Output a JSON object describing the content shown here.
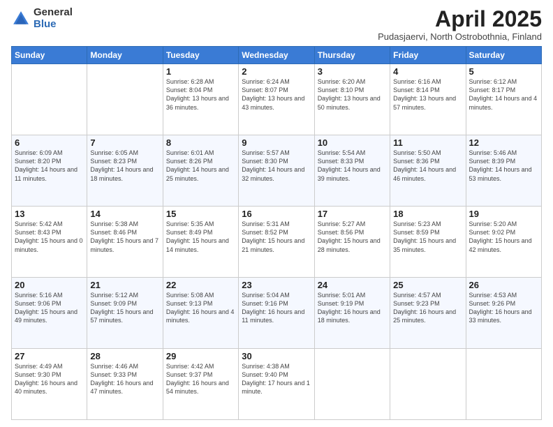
{
  "logo": {
    "general": "General",
    "blue": "Blue"
  },
  "title": "April 2025",
  "subtitle": "Pudasjaervi, North Ostrobothnia, Finland",
  "weekdays": [
    "Sunday",
    "Monday",
    "Tuesday",
    "Wednesday",
    "Thursday",
    "Friday",
    "Saturday"
  ],
  "weeks": [
    [
      {
        "day": "",
        "sunrise": "",
        "sunset": "",
        "daylight": ""
      },
      {
        "day": "",
        "sunrise": "",
        "sunset": "",
        "daylight": ""
      },
      {
        "day": "1",
        "sunrise": "Sunrise: 6:28 AM",
        "sunset": "Sunset: 8:04 PM",
        "daylight": "Daylight: 13 hours and 36 minutes."
      },
      {
        "day": "2",
        "sunrise": "Sunrise: 6:24 AM",
        "sunset": "Sunset: 8:07 PM",
        "daylight": "Daylight: 13 hours and 43 minutes."
      },
      {
        "day": "3",
        "sunrise": "Sunrise: 6:20 AM",
        "sunset": "Sunset: 8:10 PM",
        "daylight": "Daylight: 13 hours and 50 minutes."
      },
      {
        "day": "4",
        "sunrise": "Sunrise: 6:16 AM",
        "sunset": "Sunset: 8:14 PM",
        "daylight": "Daylight: 13 hours and 57 minutes."
      },
      {
        "day": "5",
        "sunrise": "Sunrise: 6:12 AM",
        "sunset": "Sunset: 8:17 PM",
        "daylight": "Daylight: 14 hours and 4 minutes."
      }
    ],
    [
      {
        "day": "6",
        "sunrise": "Sunrise: 6:09 AM",
        "sunset": "Sunset: 8:20 PM",
        "daylight": "Daylight: 14 hours and 11 minutes."
      },
      {
        "day": "7",
        "sunrise": "Sunrise: 6:05 AM",
        "sunset": "Sunset: 8:23 PM",
        "daylight": "Daylight: 14 hours and 18 minutes."
      },
      {
        "day": "8",
        "sunrise": "Sunrise: 6:01 AM",
        "sunset": "Sunset: 8:26 PM",
        "daylight": "Daylight: 14 hours and 25 minutes."
      },
      {
        "day": "9",
        "sunrise": "Sunrise: 5:57 AM",
        "sunset": "Sunset: 8:30 PM",
        "daylight": "Daylight: 14 hours and 32 minutes."
      },
      {
        "day": "10",
        "sunrise": "Sunrise: 5:54 AM",
        "sunset": "Sunset: 8:33 PM",
        "daylight": "Daylight: 14 hours and 39 minutes."
      },
      {
        "day": "11",
        "sunrise": "Sunrise: 5:50 AM",
        "sunset": "Sunset: 8:36 PM",
        "daylight": "Daylight: 14 hours and 46 minutes."
      },
      {
        "day": "12",
        "sunrise": "Sunrise: 5:46 AM",
        "sunset": "Sunset: 8:39 PM",
        "daylight": "Daylight: 14 hours and 53 minutes."
      }
    ],
    [
      {
        "day": "13",
        "sunrise": "Sunrise: 5:42 AM",
        "sunset": "Sunset: 8:43 PM",
        "daylight": "Daylight: 15 hours and 0 minutes."
      },
      {
        "day": "14",
        "sunrise": "Sunrise: 5:38 AM",
        "sunset": "Sunset: 8:46 PM",
        "daylight": "Daylight: 15 hours and 7 minutes."
      },
      {
        "day": "15",
        "sunrise": "Sunrise: 5:35 AM",
        "sunset": "Sunset: 8:49 PM",
        "daylight": "Daylight: 15 hours and 14 minutes."
      },
      {
        "day": "16",
        "sunrise": "Sunrise: 5:31 AM",
        "sunset": "Sunset: 8:52 PM",
        "daylight": "Daylight: 15 hours and 21 minutes."
      },
      {
        "day": "17",
        "sunrise": "Sunrise: 5:27 AM",
        "sunset": "Sunset: 8:56 PM",
        "daylight": "Daylight: 15 hours and 28 minutes."
      },
      {
        "day": "18",
        "sunrise": "Sunrise: 5:23 AM",
        "sunset": "Sunset: 8:59 PM",
        "daylight": "Daylight: 15 hours and 35 minutes."
      },
      {
        "day": "19",
        "sunrise": "Sunrise: 5:20 AM",
        "sunset": "Sunset: 9:02 PM",
        "daylight": "Daylight: 15 hours and 42 minutes."
      }
    ],
    [
      {
        "day": "20",
        "sunrise": "Sunrise: 5:16 AM",
        "sunset": "Sunset: 9:06 PM",
        "daylight": "Daylight: 15 hours and 49 minutes."
      },
      {
        "day": "21",
        "sunrise": "Sunrise: 5:12 AM",
        "sunset": "Sunset: 9:09 PM",
        "daylight": "Daylight: 15 hours and 57 minutes."
      },
      {
        "day": "22",
        "sunrise": "Sunrise: 5:08 AM",
        "sunset": "Sunset: 9:13 PM",
        "daylight": "Daylight: 16 hours and 4 minutes."
      },
      {
        "day": "23",
        "sunrise": "Sunrise: 5:04 AM",
        "sunset": "Sunset: 9:16 PM",
        "daylight": "Daylight: 16 hours and 11 minutes."
      },
      {
        "day": "24",
        "sunrise": "Sunrise: 5:01 AM",
        "sunset": "Sunset: 9:19 PM",
        "daylight": "Daylight: 16 hours and 18 minutes."
      },
      {
        "day": "25",
        "sunrise": "Sunrise: 4:57 AM",
        "sunset": "Sunset: 9:23 PM",
        "daylight": "Daylight: 16 hours and 25 minutes."
      },
      {
        "day": "26",
        "sunrise": "Sunrise: 4:53 AM",
        "sunset": "Sunset: 9:26 PM",
        "daylight": "Daylight: 16 hours and 33 minutes."
      }
    ],
    [
      {
        "day": "27",
        "sunrise": "Sunrise: 4:49 AM",
        "sunset": "Sunset: 9:30 PM",
        "daylight": "Daylight: 16 hours and 40 minutes."
      },
      {
        "day": "28",
        "sunrise": "Sunrise: 4:46 AM",
        "sunset": "Sunset: 9:33 PM",
        "daylight": "Daylight: 16 hours and 47 minutes."
      },
      {
        "day": "29",
        "sunrise": "Sunrise: 4:42 AM",
        "sunset": "Sunset: 9:37 PM",
        "daylight": "Daylight: 16 hours and 54 minutes."
      },
      {
        "day": "30",
        "sunrise": "Sunrise: 4:38 AM",
        "sunset": "Sunset: 9:40 PM",
        "daylight": "Daylight: 17 hours and 1 minute."
      },
      {
        "day": "",
        "sunrise": "",
        "sunset": "",
        "daylight": ""
      },
      {
        "day": "",
        "sunrise": "",
        "sunset": "",
        "daylight": ""
      },
      {
        "day": "",
        "sunrise": "",
        "sunset": "",
        "daylight": ""
      }
    ]
  ]
}
